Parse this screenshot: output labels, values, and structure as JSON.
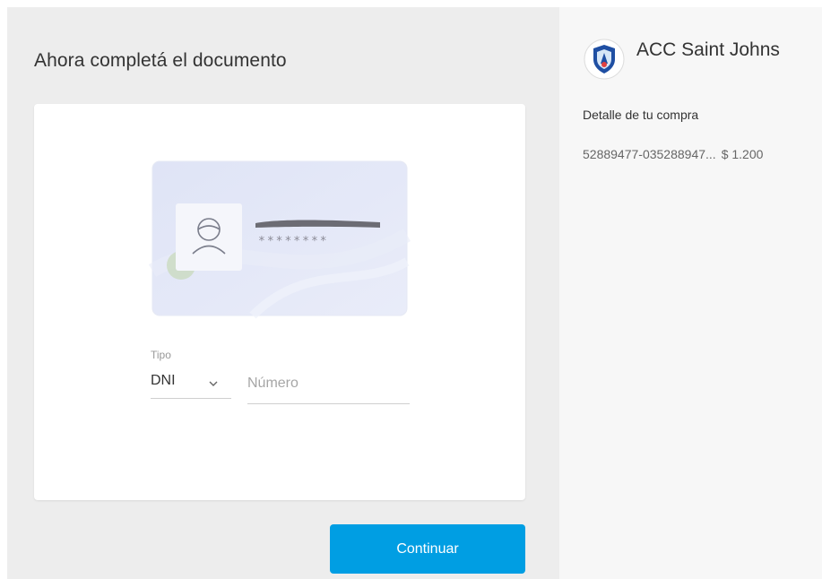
{
  "page": {
    "title": "Ahora completá el documento"
  },
  "document_preview": {
    "masked_number": "********"
  },
  "form": {
    "type_label": "Tipo",
    "type_value": "DNI",
    "number_placeholder": "Número",
    "number_value": "",
    "submit_label": "Continuar"
  },
  "summary": {
    "store_name": "ACC Saint Johns",
    "detail_title": "Detalle de tu compra",
    "item_description": "52889477-035288947...",
    "item_price": "$ 1.200"
  },
  "colors": {
    "accent": "#009ee3",
    "main_background": "#ededed",
    "side_background": "#f7f7f7",
    "shield_blue": "#1f4fa3"
  },
  "icons": {
    "avatar": "person-icon",
    "select": "chevron-down-icon",
    "logo": "shield-icon"
  }
}
